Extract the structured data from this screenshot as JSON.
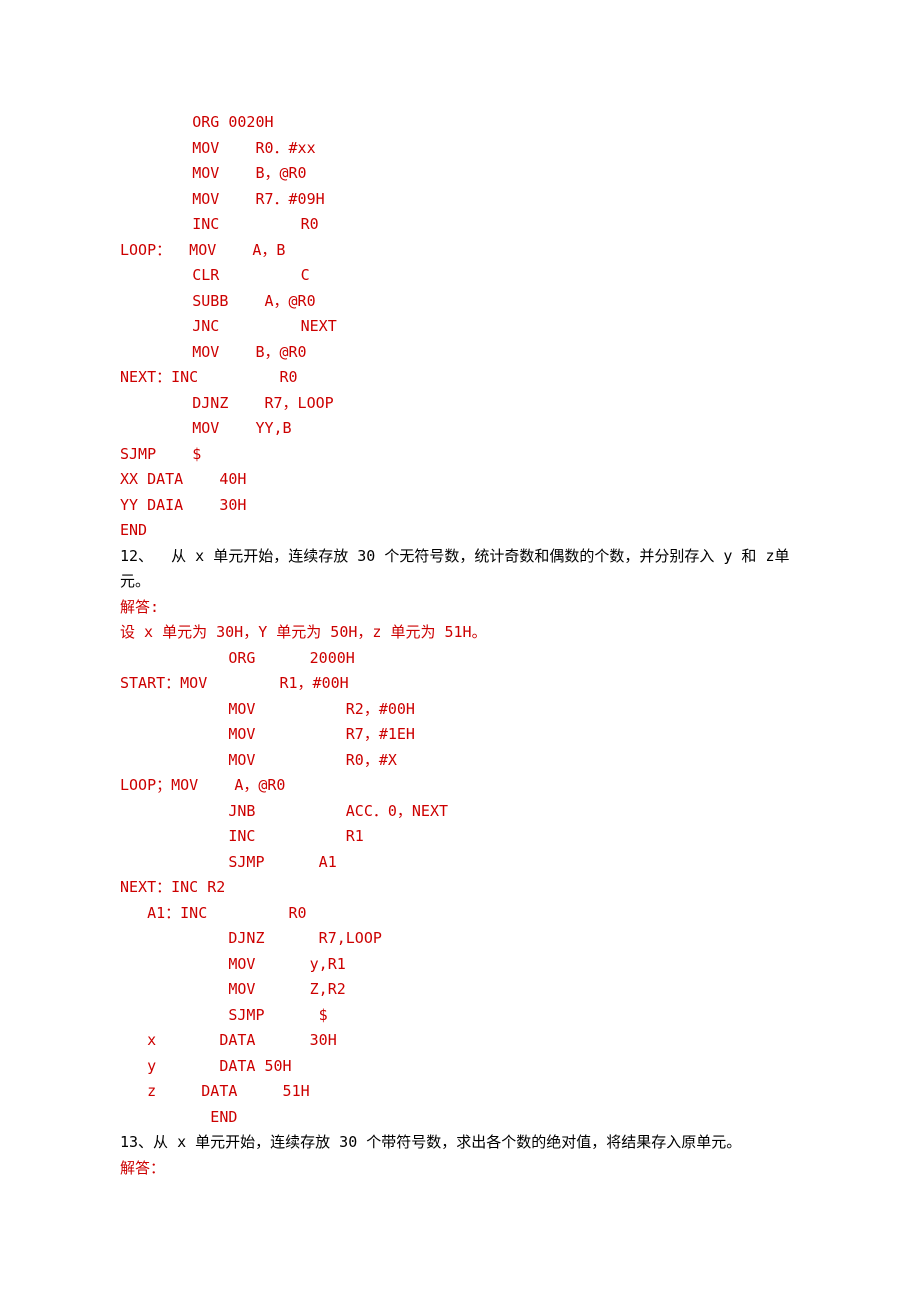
{
  "lines": [
    {
      "text": "        ORG 0020H",
      "color": "red"
    },
    {
      "text": "        MOV    R0．#xx",
      "color": "red"
    },
    {
      "text": "        MOV    B，@R0",
      "color": "red"
    },
    {
      "text": "        MOV    R7．#09H",
      "color": "red"
    },
    {
      "text": "        INC         R0",
      "color": "red"
    },
    {
      "text": "LOOP：  MOV    A，B",
      "color": "red"
    },
    {
      "text": "        CLR         C",
      "color": "red"
    },
    {
      "text": "        SUBB    A，@R0",
      "color": "red"
    },
    {
      "text": "        JNC         NEXT",
      "color": "red"
    },
    {
      "text": "        MOV    B，@R0",
      "color": "red"
    },
    {
      "text": "NEXT：INC         R0",
      "color": "red"
    },
    {
      "text": "        DJNZ    R7，LOOP",
      "color": "red"
    },
    {
      "text": "        MOV    YY,B",
      "color": "red"
    },
    {
      "text": "SJMP    $",
      "color": "red"
    },
    {
      "text": "XX DATA    40H",
      "color": "red"
    },
    {
      "text": "YY DAIA    30H",
      "color": "red"
    },
    {
      "text": "END",
      "color": "red"
    },
    {
      "text": "12、  从 x 单元开始，连续存放 30 个无符号数，统计奇数和偶数的个数，并分别存入 y 和 z单元。",
      "color": "black"
    },
    {
      "text": "解答:",
      "color": "red"
    },
    {
      "text": "设 x 单元为 30H，Y 单元为 50H，z 单元为 51H。",
      "color": "red"
    },
    {
      "text": "            ORG      2000H",
      "color": "red"
    },
    {
      "text": "START：MOV        R1，#00H",
      "color": "red"
    },
    {
      "text": "            MOV          R2，#00H",
      "color": "red"
    },
    {
      "text": "            MOV          R7，#1EH",
      "color": "red"
    },
    {
      "text": "            MOV          R0，#X",
      "color": "red"
    },
    {
      "text": "LOOP；MOV    A，@R0",
      "color": "red"
    },
    {
      "text": "            JNB          ACC．0，NEXT",
      "color": "red"
    },
    {
      "text": "            INC          R1",
      "color": "red"
    },
    {
      "text": "            SJMP      A1",
      "color": "red"
    },
    {
      "text": "NEXT：INC R2",
      "color": "red"
    },
    {
      "text": "   A1：INC         R0",
      "color": "red"
    },
    {
      "text": "            DJNZ      R7,LOOP",
      "color": "red"
    },
    {
      "text": "            MOV      y,R1",
      "color": "red"
    },
    {
      "text": "            MOV      Z,R2",
      "color": "red"
    },
    {
      "text": "            SJMP      $",
      "color": "red"
    },
    {
      "text": "   x       DATA      30H",
      "color": "red"
    },
    {
      "text": "   y       DATA 50H",
      "color": "red"
    },
    {
      "text": "   z     DATA     51H",
      "color": "red"
    },
    {
      "text": "          END",
      "color": "red"
    },
    {
      "text": "13、从 x 单元开始，连续存放 30 个带符号数，求出各个数的绝对值，将结果存入原单元。",
      "color": "black"
    },
    {
      "text": "解答：",
      "color": "red"
    }
  ]
}
